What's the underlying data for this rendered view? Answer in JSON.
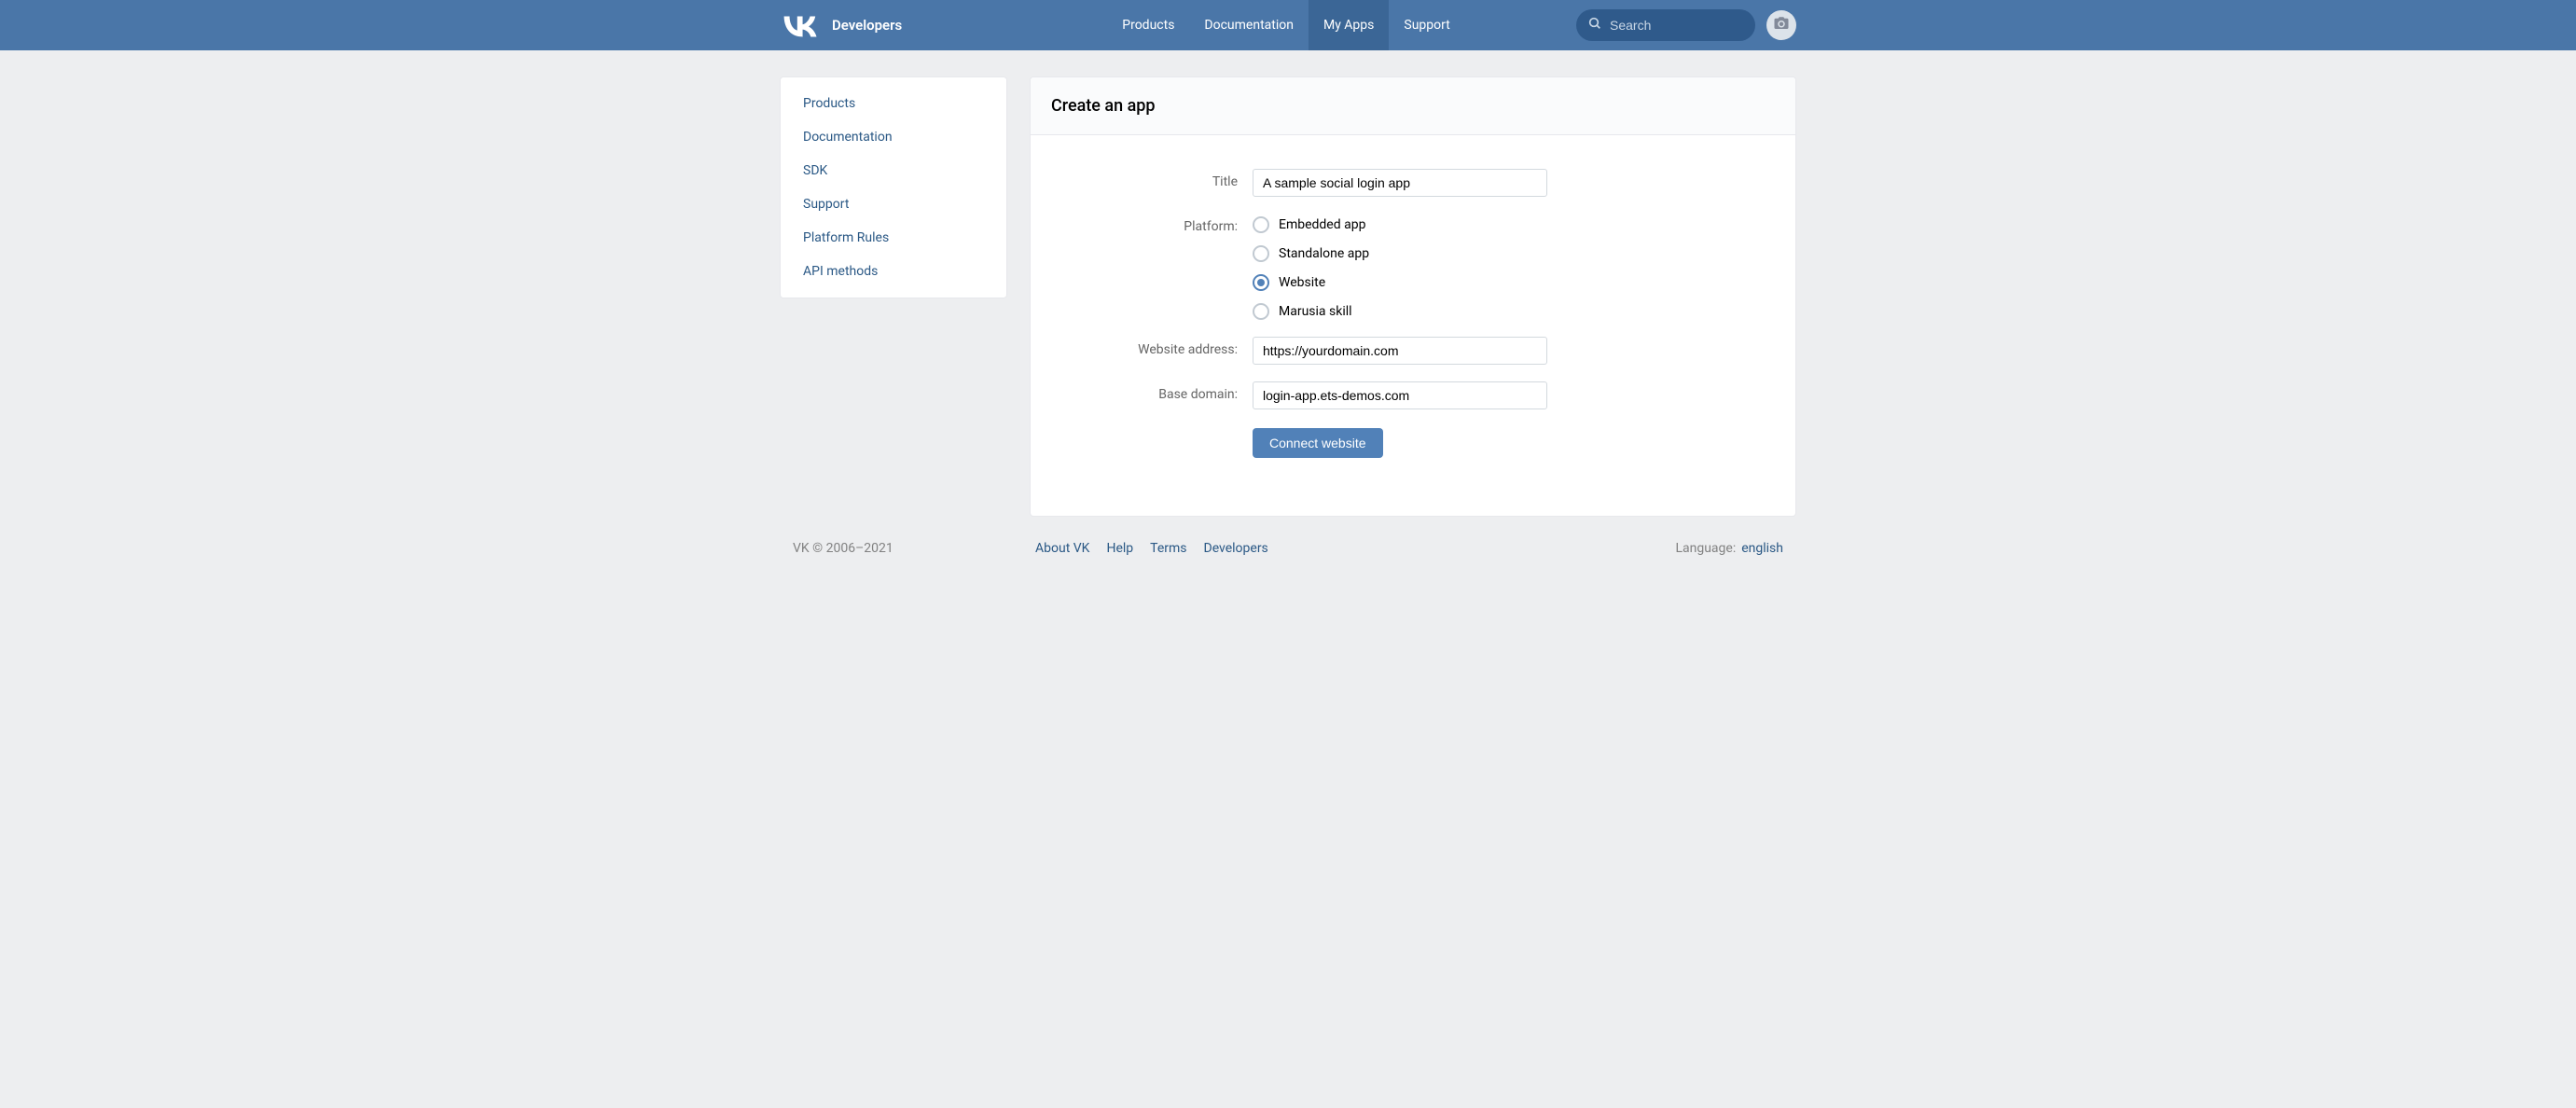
{
  "brand": {
    "name": "Developers"
  },
  "nav": {
    "items": [
      {
        "label": "Products",
        "active": false
      },
      {
        "label": "Documentation",
        "active": false
      },
      {
        "label": "My Apps",
        "active": true
      },
      {
        "label": "Support",
        "active": false
      }
    ]
  },
  "search": {
    "placeholder": "Search"
  },
  "sidebar": {
    "items": [
      {
        "label": "Products"
      },
      {
        "label": "Documentation"
      },
      {
        "label": "SDK"
      },
      {
        "label": "Support"
      },
      {
        "label": "Platform Rules"
      },
      {
        "label": "API methods"
      }
    ]
  },
  "main": {
    "title": "Create an app",
    "form": {
      "title_label": "Title",
      "title_value": "A sample social login app",
      "platform_label": "Platform:",
      "platform_options": [
        {
          "label": "Embedded app",
          "checked": false
        },
        {
          "label": "Standalone app",
          "checked": false
        },
        {
          "label": "Website",
          "checked": true
        },
        {
          "label": "Marusia skill",
          "checked": false
        }
      ],
      "website_address_label": "Website address:",
      "website_address_value": "https://yourdomain.com",
      "base_domain_label": "Base domain:",
      "base_domain_value": "login-app.ets-demos.com",
      "submit_label": "Connect website"
    }
  },
  "footer": {
    "copyright": "VK © 2006–2021",
    "links": [
      {
        "label": "About VK"
      },
      {
        "label": "Help"
      },
      {
        "label": "Terms"
      },
      {
        "label": "Developers"
      }
    ],
    "language_label": "Language:",
    "language_value": "english"
  }
}
